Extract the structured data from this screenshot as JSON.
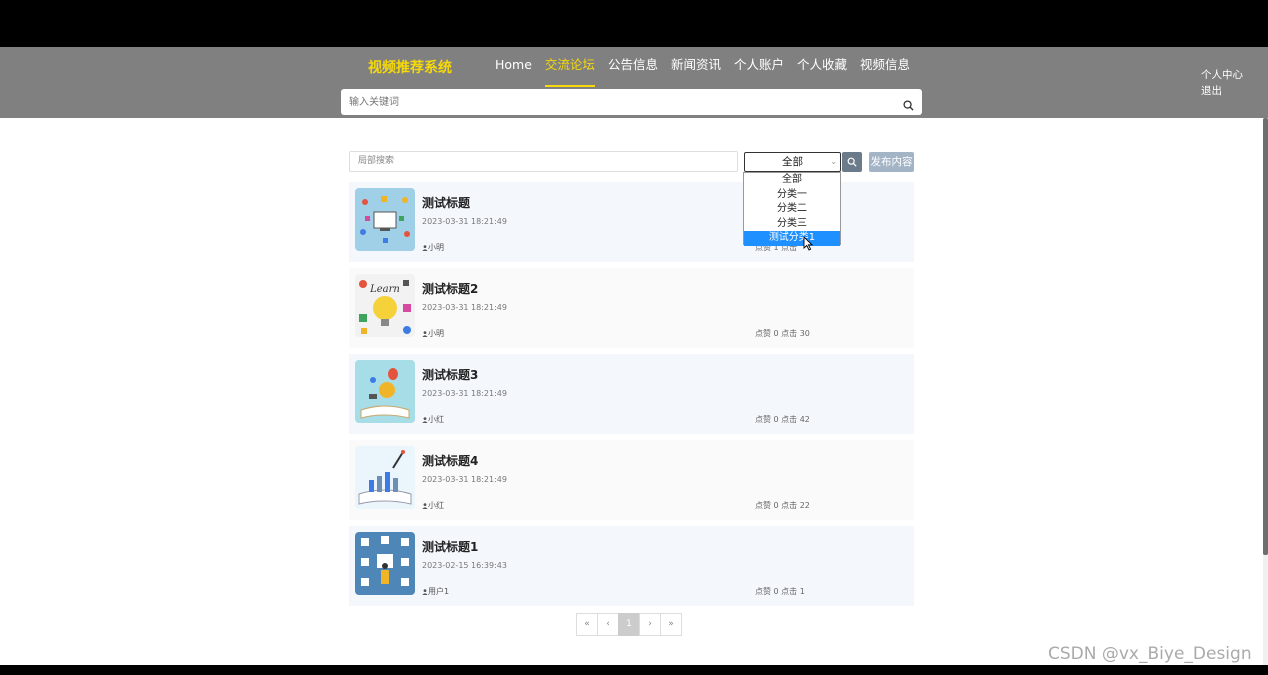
{
  "header": {
    "brand": "视频推荐系统",
    "nav": [
      "Home",
      "交流论坛",
      "公告信息",
      "新闻资讯",
      "个人账户",
      "个人收藏",
      "视频信息"
    ],
    "active_nav": "交流论坛",
    "search_placeholder": "输入关键词",
    "user_center": "个人中心",
    "logout": "退出"
  },
  "toolbar": {
    "local_search_placeholder": "局部搜索",
    "category_selected": "全部",
    "category_options": [
      "全部",
      "分类一",
      "分类二",
      "分类三",
      "测试分类1"
    ],
    "highlighted_option": "测试分类1",
    "publish_label": "发布内容"
  },
  "posts": [
    {
      "title": "测试标题",
      "time": "2023-03-31 18:21:49",
      "author": "小明",
      "stats": "点赞 1 点击"
    },
    {
      "title": "测试标题2",
      "time": "2023-03-31 18:21:49",
      "author": "小明",
      "stats": "点赞 0 点击 30"
    },
    {
      "title": "测试标题3",
      "time": "2023-03-31 18:21:49",
      "author": "小红",
      "stats": "点赞 0 点击 42"
    },
    {
      "title": "测试标题4",
      "time": "2023-03-31 18:21:49",
      "author": "小红",
      "stats": "点赞 0 点击 22"
    },
    {
      "title": "测试标题1",
      "time": "2023-02-15 16:39:43",
      "author": "用户1",
      "stats": "点赞 0 点击 1"
    }
  ],
  "pager": {
    "first": "«",
    "prev": "‹",
    "current": "1",
    "next": "›",
    "last": "»"
  },
  "watermark": "CSDN @vx_Biye_Design",
  "colors": {
    "accent": "#f5d90a",
    "header_bg": "#808080",
    "highlight": "#1e90ff"
  }
}
